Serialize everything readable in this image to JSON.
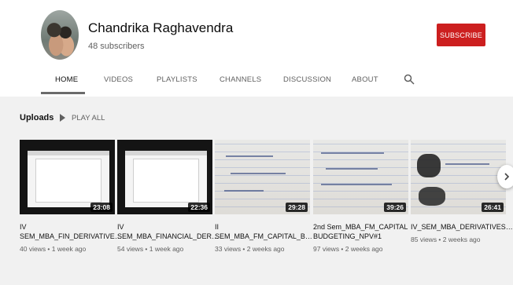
{
  "channel": {
    "name": "Chandrika Raghavendra",
    "subscribers": "48 subscribers",
    "subscribe_label": "SUBSCRIBE"
  },
  "tabs": [
    {
      "label": "HOME",
      "active": true
    },
    {
      "label": "VIDEOS"
    },
    {
      "label": "PLAYLISTS"
    },
    {
      "label": "CHANNELS"
    },
    {
      "label": "DISCUSSION"
    },
    {
      "label": "ABOUT"
    }
  ],
  "section": {
    "title": "Uploads",
    "play_all_label": "PLAY ALL"
  },
  "videos": [
    {
      "title": "IV\nSEM_MBA_FIN_DERIVATIVE…",
      "duration": "23:08",
      "meta": "40 views • 1 week ago"
    },
    {
      "title": "IV\nSEM_MBA_FINANCIAL_DER…",
      "duration": "22:36",
      "meta": "54 views • 1 week ago"
    },
    {
      "title": "II\nSEM_MBA_FM_CAPITAL_B…",
      "duration": "29:28",
      "meta": "33 views • 2 weeks ago"
    },
    {
      "title": "2nd Sem_MBA_FM_CAPITAL\nBUDGETING_NPV#1",
      "duration": "39:26",
      "meta": "97 views • 2 weeks ago"
    },
    {
      "title": "IV_SEM_MBA_DERIVATIVES…",
      "duration": "26:41",
      "meta": "85 views • 2 weeks ago"
    }
  ],
  "icons": {
    "search": "search-icon",
    "play": "play-icon",
    "next": "chevron-right-icon"
  },
  "colors": {
    "subscribe": "#cc1f1f",
    "uploads_bg": "#f1f1f1"
  }
}
